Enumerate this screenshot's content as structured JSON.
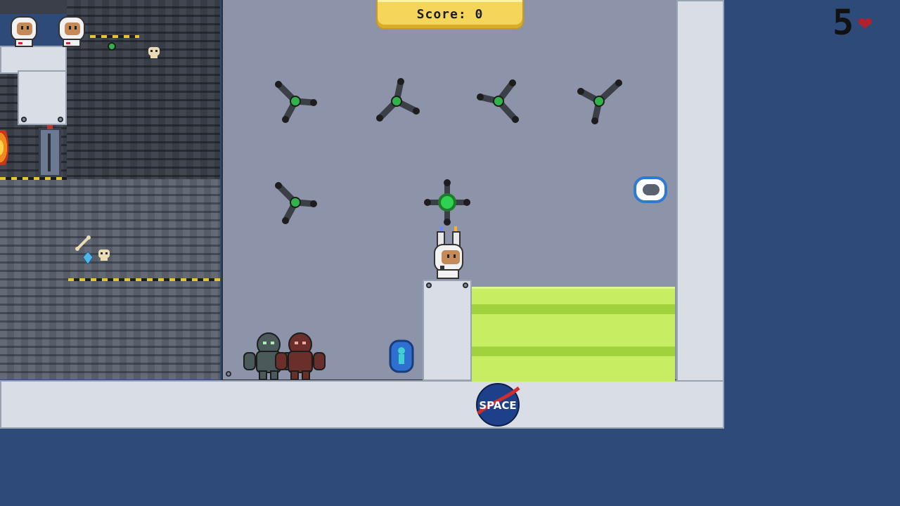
{
  "hud": {
    "score_label": "Score:",
    "score_value": "0",
    "lives": "5",
    "lives_icon": "heart-icon"
  },
  "world": {
    "logo_text": "SPACE",
    "colors": {
      "background": "#2e4a78",
      "chamber": "#8d93a8",
      "panel": "#d8dde6",
      "acid": "#b9e24a",
      "score_pill": "#f5d55a",
      "heart": "#b3202b",
      "drone_core": "#2fb34a"
    },
    "sprites": {
      "player": "astronaut-player",
      "spare_lives": "astronaut-life-icon",
      "drones": "tri-arm-drone",
      "boss_drone": "quad-arm-drone",
      "enemies": [
        "grey-alien",
        "red-alien"
      ],
      "pickups": [
        "blue-capsule-pickup",
        "shield-pod-pickup",
        "skull",
        "bone",
        "crystal"
      ],
      "hazards": [
        "acid-pool",
        "fire"
      ],
      "door": "airlock-door"
    }
  }
}
